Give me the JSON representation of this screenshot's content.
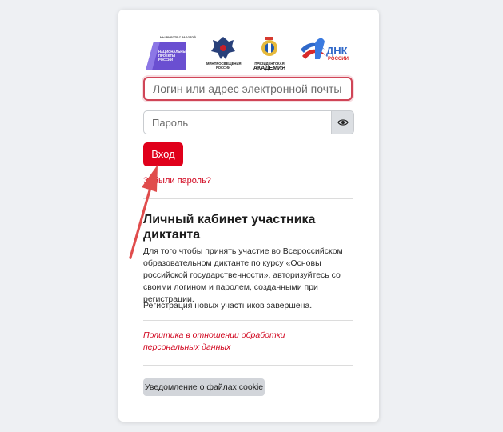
{
  "logos": [
    {
      "icon": "naczionalnye-proekty-logo-icon",
      "lines": [
        "НАЦИОНАЛЬНЫЕ",
        "ПРОЕКТЫ",
        "РОССИИ"
      ],
      "top": "МЫ ВМЕСТЕ С РАБОТОЙ"
    },
    {
      "icon": "minprosveshcheniya-emblem-icon",
      "lines": [
        "МИНПРОСВЕЩЕНИЯ",
        "РОССИИ"
      ]
    },
    {
      "icon": "ranepa-emblem-icon",
      "lines": [
        "ПРЕЗИДЕНТСКАЯ",
        "АКАДЕМИЯ"
      ]
    },
    {
      "icon": "dnk-rossii-logo-icon",
      "lines": [
        "ДНК",
        "РОССИИ"
      ]
    }
  ],
  "form": {
    "login_placeholder": "Логин или адрес электронной почты",
    "password_placeholder": "Пароль",
    "login_button": "Вход",
    "forgot_link": "Забыли пароль?"
  },
  "info": {
    "heading": "Личный кабинет участника диктанта",
    "description": "Для того чтобы принять участие во Всероссийском образовательном диктанте по курсу «Основы российской государственности», авторизуйтесь со своими логином и паролем, созданными при регистрации.",
    "registration_closed": "Регистрация новых участников завершена."
  },
  "policy_link": "Политика в отношении обработки персональных данных",
  "cookie_button": "Уведомление о файлах cookie",
  "colors": {
    "accent": "#e0001b",
    "link": "#d0021b",
    "arrow": "#e04c4c"
  }
}
